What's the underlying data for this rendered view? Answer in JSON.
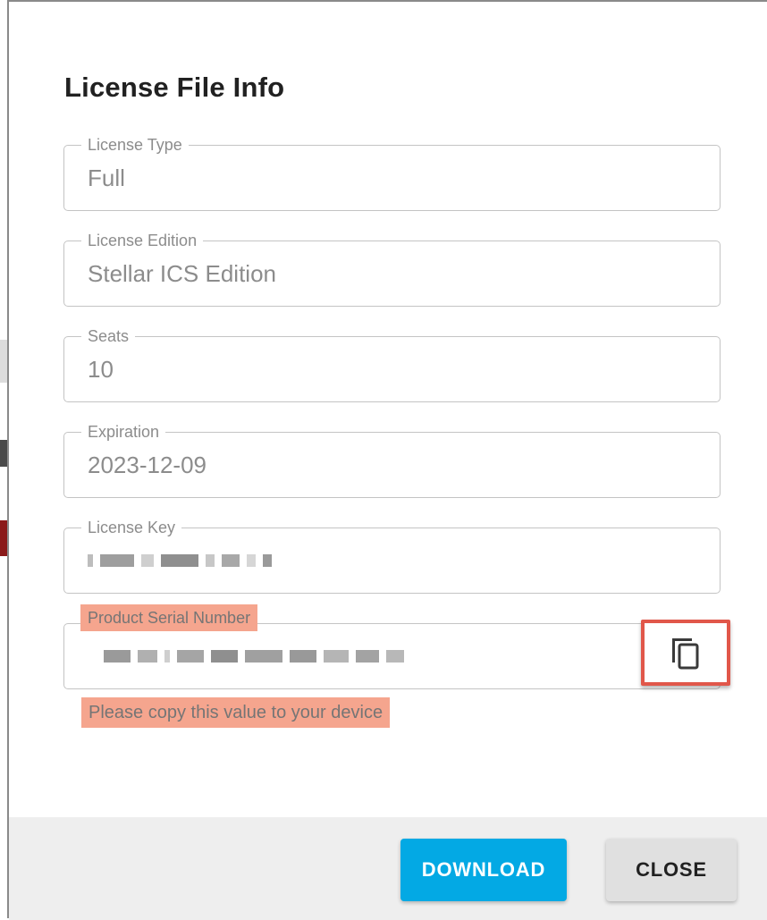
{
  "dialog": {
    "title": "License File Info"
  },
  "fields": {
    "license_type": {
      "label": "License Type",
      "value": "Full"
    },
    "license_edition": {
      "label": "License Edition",
      "value": "Stellar ICS Edition"
    },
    "seats": {
      "label": "Seats",
      "value": "10"
    },
    "expiration": {
      "label": "Expiration",
      "value": "2023-12-09"
    },
    "license_key": {
      "label": "License Key"
    },
    "product_serial": {
      "label": "Product Serial Number",
      "helper_text": "Please copy this value to your device"
    }
  },
  "copy_button": {
    "icon": "copy-icon"
  },
  "footer": {
    "download_label": "DOWNLOAD",
    "close_label": "CLOSE"
  },
  "colors": {
    "primary": "#03a9e4",
    "highlight": "#f5a58e",
    "copy_outline": "#e1574a"
  }
}
